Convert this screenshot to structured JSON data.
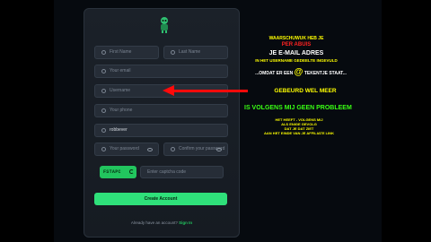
{
  "form": {
    "first_name_placeholder": "First Name",
    "last_name_placeholder": "Last Name",
    "email_placeholder": "Your email",
    "username_placeholder": "Username",
    "phone_placeholder": "Your phone",
    "referral_value": "robbever",
    "password_placeholder": "Your password",
    "confirm_password_placeholder": "Confirm your password",
    "captcha_code": "FSTAPC",
    "captcha_placeholder": "Enter captcha code",
    "create_button": "Create Account",
    "signin_prompt": "Already have an account?",
    "signin_link": "Sign In"
  },
  "annotations": {
    "line1": "WAARSCHUWUK HEB JE",
    "line2": "PER ABUIS",
    "line3": "JE E-MAIL ADRES",
    "line4": "IN HET USERNAME GEDEELTE INGEVULD",
    "line5a": "...OMDAT ER EEN",
    "line5_symbol": "@",
    "line5b": "TEKENTJE STAAT...",
    "line6": "GEBEURD WEL MEER",
    "line7": "IS VOLGENS MIJ GEEN PROBLEEM",
    "line8": "HET HEEFT - VOLGENS MIJ",
    "line9": "ALS ENIGE GEVOLG",
    "line10": "DAT JE DAT ZIET",
    "line11": "AAN HET EINDE VAN JE AFFILIATE LINK"
  },
  "colors": {
    "accent_green": "#2fe07a",
    "arrow_red": "#ff0a0a",
    "annotation_yellow": "#ffff00",
    "annotation_green": "#39ff14"
  },
  "icons": [
    "app-logo-icon",
    "user-icon",
    "email-icon",
    "at-icon",
    "phone-icon",
    "lock-icon",
    "eye-icon",
    "refresh-icon"
  ]
}
